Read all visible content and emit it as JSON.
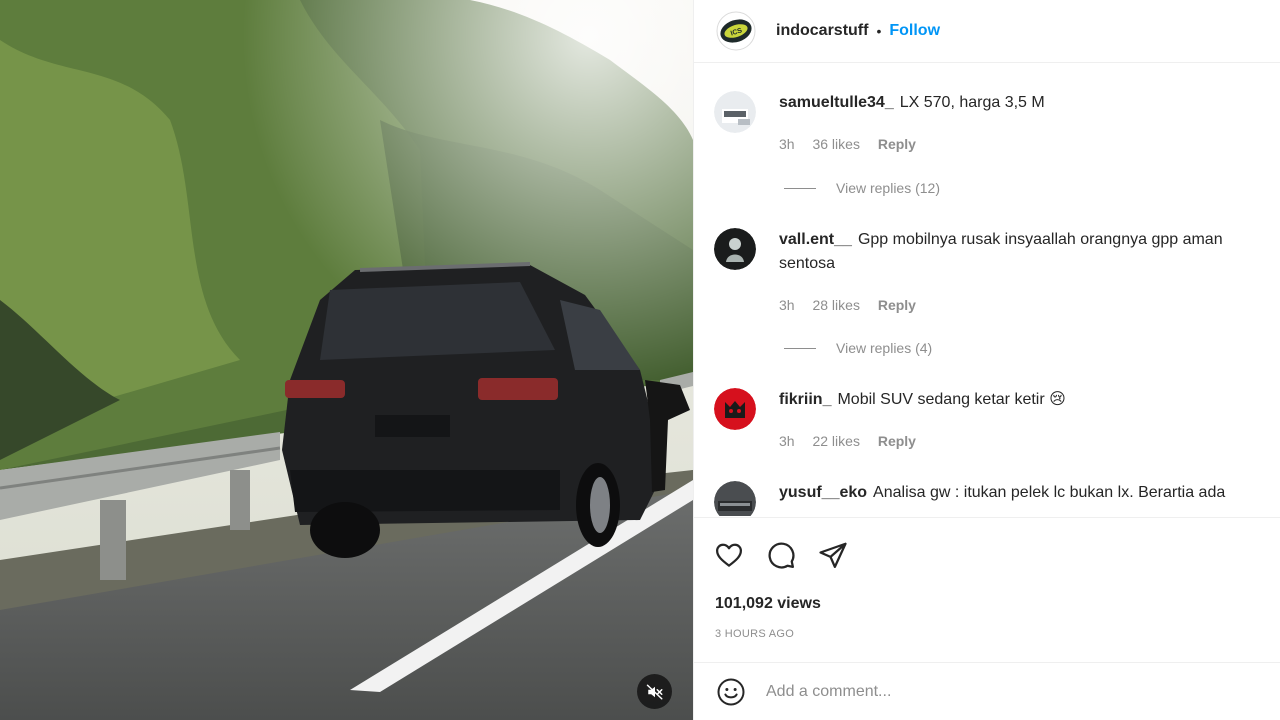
{
  "post": {
    "account": "indocarstuff",
    "separator": "•",
    "follow_label": "Follow"
  },
  "comments": [
    {
      "user": "samueltulle34_",
      "text": "LX 570, harga 3,5 M",
      "time": "3h",
      "likes": "36 likes",
      "reply_label": "Reply",
      "view_replies": "View replies (12)"
    },
    {
      "user": "vall.ent__",
      "text": "Gpp mobilnya rusak insyaallah orangnya gpp aman sentosa",
      "time": "3h",
      "likes": "28 likes",
      "reply_label": "Reply",
      "view_replies": "View replies (4)"
    },
    {
      "user": "fikriin_",
      "text": "Mobil SUV sedang ketar ketir",
      "emoji": "😢",
      "time": "3h",
      "likes": "22 likes",
      "reply_label": "Reply"
    },
    {
      "user": "yusuf__eko",
      "text": "Analisa gw : itukan pelek lc bukan lx. Berartia ada"
    }
  ],
  "actions": {
    "like_icon": "heart-icon",
    "comment_icon": "comment-bubble-icon",
    "share_icon": "paper-plane-icon"
  },
  "stats": {
    "views": "101,092 views",
    "posted": "3 HOURS AGO"
  },
  "composer": {
    "placeholder": "Add a comment..."
  },
  "video": {
    "mute_icon": "speaker-muted-icon"
  },
  "colors": {
    "accent": "#0095f6",
    "text": "#262626",
    "secondary": "#8e8e8e",
    "divider": "#efefef"
  }
}
